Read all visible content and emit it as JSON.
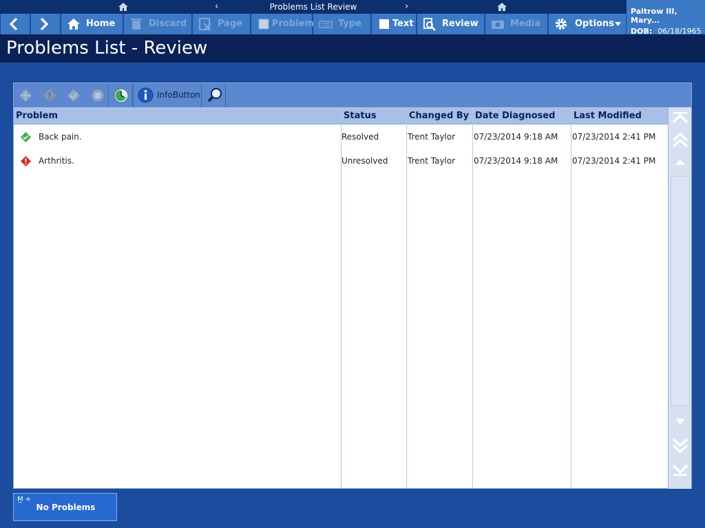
{
  "header": {
    "page_title": "Problems List Review",
    "prev_symbol": "‹",
    "next_symbol": "›"
  },
  "toolbar": {
    "home": "Home",
    "discard": "Discard",
    "page": "Page",
    "problem": "Problem",
    "type": "Type",
    "text": "Text",
    "review": "Review",
    "media": "Media",
    "options": "Options"
  },
  "patient": {
    "name": "Paltrow III, Mary...",
    "dob_label": "DOB:",
    "dob": "06/18/1965"
  },
  "title": "Problems List - Review",
  "subtoolbar": {
    "info_button": "InfoButton"
  },
  "table": {
    "columns": [
      "Problem",
      "Status",
      "Changed By",
      "Date Diagnosed",
      "Last Modified"
    ],
    "rows": [
      {
        "problem": "Back pain.",
        "status": "Resolved",
        "changed_by": "Trent Taylor",
        "date_diagnosed": "07/23/2014 9:18 AM",
        "last_modified": "07/23/2014 2:41 PM",
        "icon": "resolved-check-icon"
      },
      {
        "problem": "Arthritis.",
        "status": "Unresolved",
        "changed_by": "Trent Taylor",
        "date_diagnosed": "07/23/2014 9:18 AM",
        "last_modified": "07/23/2014 2:41 PM",
        "icon": "unresolved-alert-icon"
      }
    ]
  },
  "bottom": {
    "m_tag": "M̲ +",
    "no_problems": "No Problems"
  },
  "colors": {
    "accent": "#3c7ac6",
    "title_bg": "#0a2257",
    "page_bg": "#1c4c9e",
    "resolved": "#3fae3f",
    "unresolved": "#d42a2a"
  }
}
